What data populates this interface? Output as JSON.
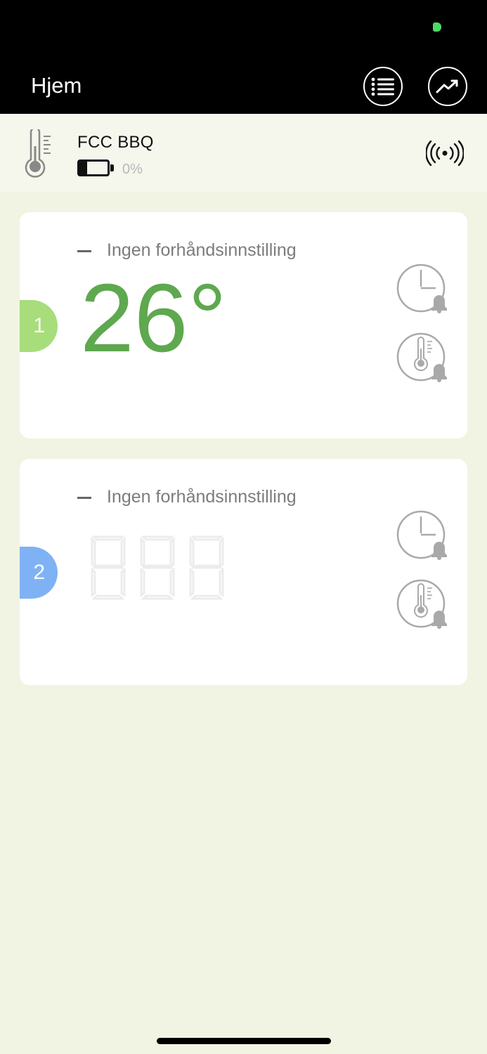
{
  "header": {
    "title": "Hjem",
    "list_icon": "list-icon",
    "chart_icon": "trend-chart-icon"
  },
  "device": {
    "name": "FCC BBQ",
    "battery_percent": "0%",
    "battery_level": 0.28,
    "icon": "thermometer-icon",
    "signal_icon": "wireless-signal-icon"
  },
  "probes": [
    {
      "number": "1",
      "preset": "Ingen forhåndsinnstilling",
      "temperature": "26°",
      "badge_color": "#a7dd7b",
      "timer_alarm_icon": "timer-alarm-icon",
      "temp_alarm_icon": "temperature-alarm-icon"
    },
    {
      "number": "2",
      "preset": "Ingen forhåndsinnstilling",
      "temperature": "",
      "badge_color": "#7fb2f5",
      "timer_alarm_icon": "timer-alarm-icon",
      "temp_alarm_icon": "temperature-alarm-icon"
    }
  ],
  "colors": {
    "temp_green": "#5ea84f",
    "background": "#f1f4e2"
  }
}
